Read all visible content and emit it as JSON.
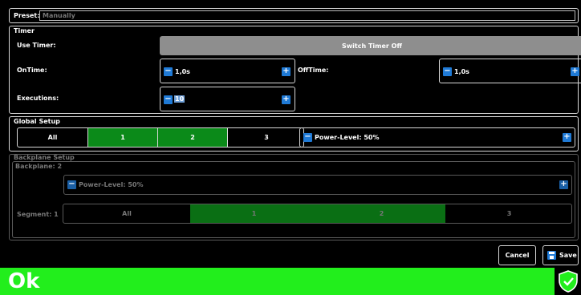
{
  "preset": {
    "label": "Preset:",
    "value": "Manually"
  },
  "timer": {
    "title": "Timer",
    "use_timer_label": "Use Timer:",
    "switch_button": "Switch Timer Off",
    "on_time_label": "OnTime:",
    "on_time_value": "1,0s",
    "off_time_label": "OffTime:",
    "off_time_value": "1,0s",
    "executions_label": "Executions:",
    "executions_value": "10"
  },
  "global_setup": {
    "title": "Global Setup",
    "segments": [
      "All",
      "1",
      "2",
      "3"
    ],
    "selected": [
      "1",
      "2"
    ],
    "power_level": "Power-Level: 50%"
  },
  "backplane_setup": {
    "title": "Backplane Setup",
    "backplane_label": "Backplane: 2",
    "power_level": "Power-Level: 50%",
    "segment_label": "Segment: 1",
    "segments": [
      "All",
      "1",
      "2",
      "3"
    ],
    "selected": [
      "1",
      "2"
    ]
  },
  "actions": {
    "cancel": "Cancel",
    "save": "Save"
  },
  "status": {
    "text": "Ok",
    "color": "#22ee1c"
  },
  "icons": {
    "minus": "−",
    "plus": "+"
  }
}
